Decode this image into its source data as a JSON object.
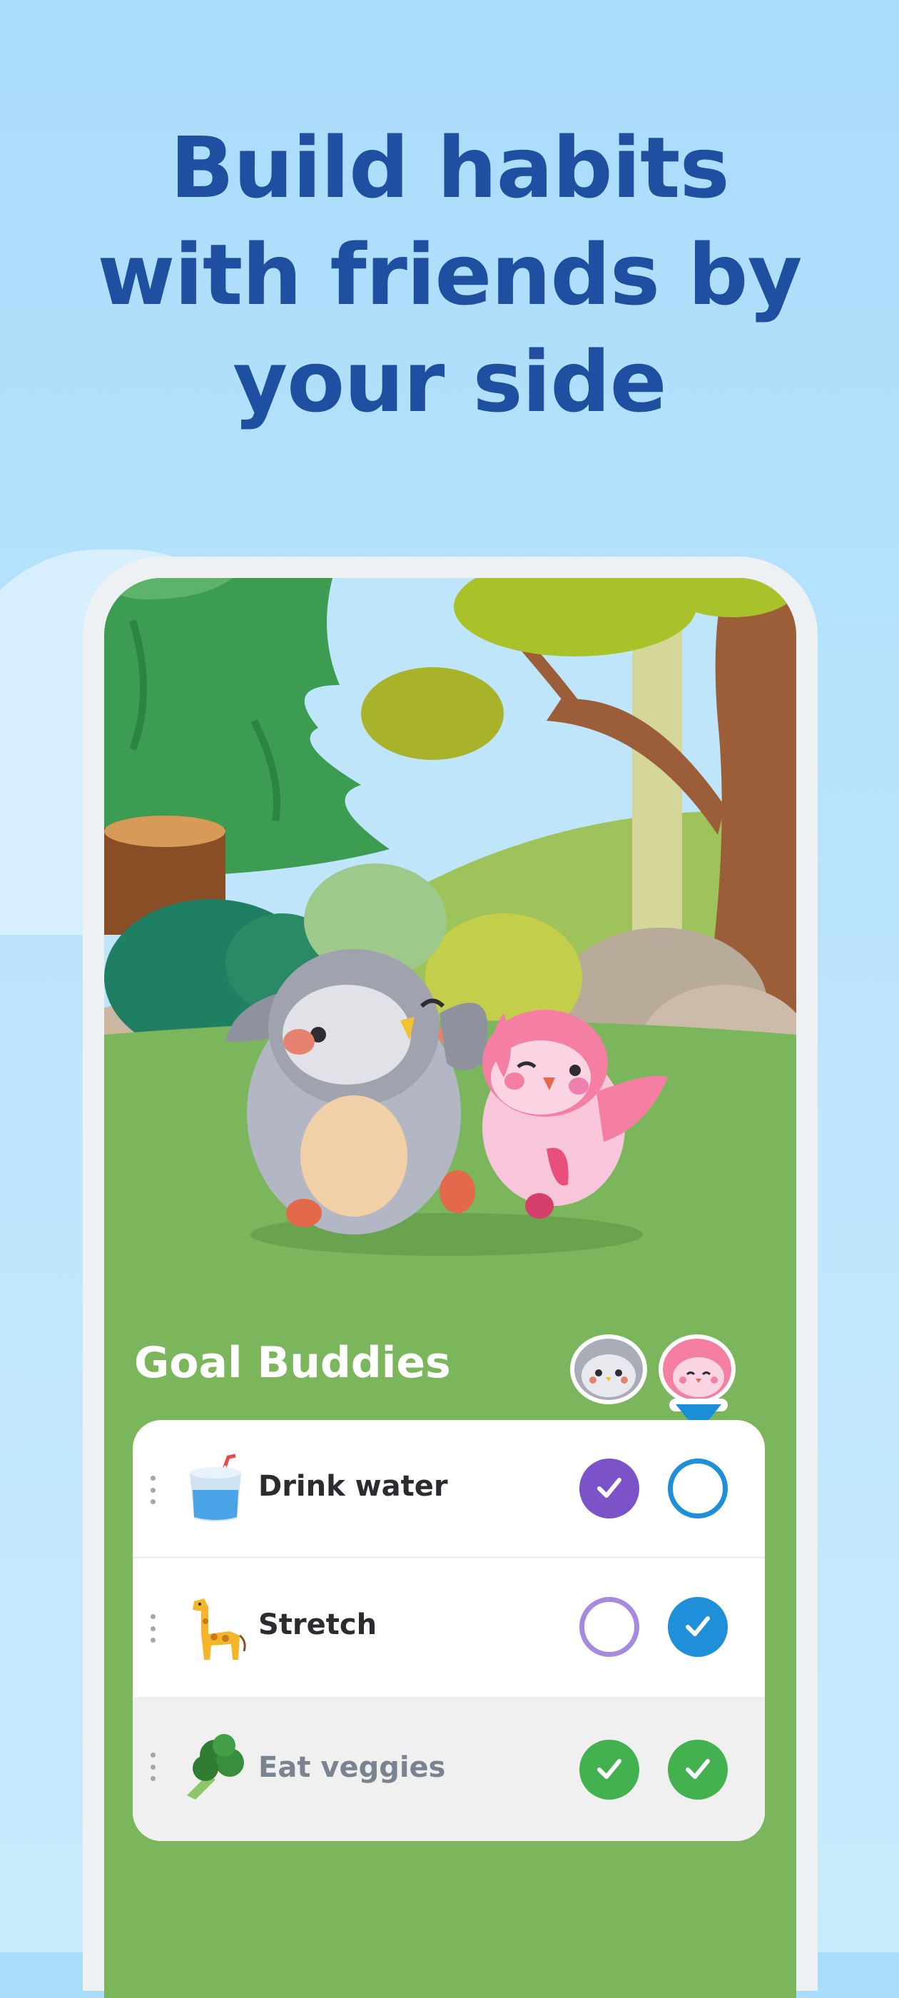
{
  "headline": {
    "line1": "Build habits",
    "line2": "with friends by",
    "line3": "your side"
  },
  "colors": {
    "background": "#a9dcfb",
    "headline": "#1f4fa0",
    "grass": "#7cb65c",
    "purple": "#7c52c8",
    "blue": "#1e8fd8",
    "green": "#44b150"
  },
  "buddies": {
    "title": "Goal Buddies",
    "avatars": [
      "grey-penguin-avatar",
      "pink-bird-avatar"
    ],
    "selected_avatar": "pink-bird-avatar"
  },
  "habits": [
    {
      "label": "Drink water",
      "icon": "cup-with-straw-icon",
      "buddy1": "checked",
      "buddy2": "unchecked"
    },
    {
      "label": "Stretch",
      "icon": "giraffe-icon",
      "buddy1": "unchecked",
      "buddy2": "checked"
    },
    {
      "label": "Eat veggies",
      "icon": "broccoli-icon",
      "buddy1": "checked",
      "buddy2": "checked"
    }
  ]
}
